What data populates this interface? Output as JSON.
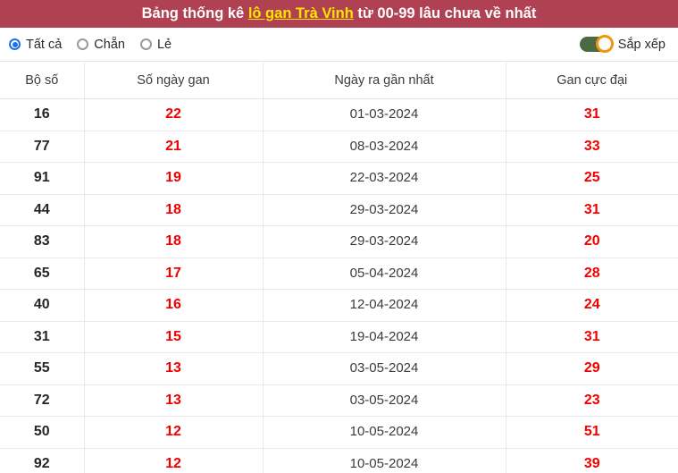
{
  "header": {
    "title_prefix": "Bảng thống kê ",
    "title_link": "lô gan Trà Vinh",
    "title_suffix": " từ 00-99 lâu chưa về nhất",
    "background_color": "#b04152",
    "link_color": "#ffe400"
  },
  "controls": {
    "radios": [
      {
        "label": "Tất cả",
        "checked": true
      },
      {
        "label": "Chẵn",
        "checked": false
      },
      {
        "label": "Lẻ",
        "checked": false
      }
    ],
    "accent_color": "#1a73e8",
    "toggle": {
      "label": "Sắp xếp",
      "on": true,
      "track_color": "#4c6a42",
      "knob_ring_color": "#f2960f"
    }
  },
  "table": {
    "columns": [
      "Bộ số",
      "Số ngày gan",
      "Ngày ra gần nhất",
      "Gan cực đại"
    ],
    "value_color": "#f20000",
    "rows": [
      {
        "bo_so": "16",
        "so_ngay_gan": "22",
        "ngay_ra": "01-03-2024",
        "gan_cuc_dai": "31"
      },
      {
        "bo_so": "77",
        "so_ngay_gan": "21",
        "ngay_ra": "08-03-2024",
        "gan_cuc_dai": "33"
      },
      {
        "bo_so": "91",
        "so_ngay_gan": "19",
        "ngay_ra": "22-03-2024",
        "gan_cuc_dai": "25"
      },
      {
        "bo_so": "44",
        "so_ngay_gan": "18",
        "ngay_ra": "29-03-2024",
        "gan_cuc_dai": "31"
      },
      {
        "bo_so": "83",
        "so_ngay_gan": "18",
        "ngay_ra": "29-03-2024",
        "gan_cuc_dai": "20"
      },
      {
        "bo_so": "65",
        "so_ngay_gan": "17",
        "ngay_ra": "05-04-2024",
        "gan_cuc_dai": "28"
      },
      {
        "bo_so": "40",
        "so_ngay_gan": "16",
        "ngay_ra": "12-04-2024",
        "gan_cuc_dai": "24"
      },
      {
        "bo_so": "31",
        "so_ngay_gan": "15",
        "ngay_ra": "19-04-2024",
        "gan_cuc_dai": "31"
      },
      {
        "bo_so": "55",
        "so_ngay_gan": "13",
        "ngay_ra": "03-05-2024",
        "gan_cuc_dai": "29"
      },
      {
        "bo_so": "72",
        "so_ngay_gan": "13",
        "ngay_ra": "03-05-2024",
        "gan_cuc_dai": "23"
      },
      {
        "bo_so": "50",
        "so_ngay_gan": "12",
        "ngay_ra": "10-05-2024",
        "gan_cuc_dai": "51"
      },
      {
        "bo_so": "92",
        "so_ngay_gan": "12",
        "ngay_ra": "10-05-2024",
        "gan_cuc_dai": "39"
      }
    ]
  }
}
